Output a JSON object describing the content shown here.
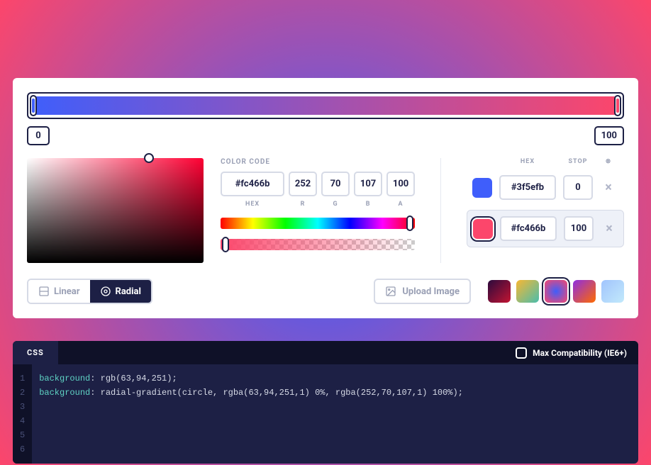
{
  "gradient": {
    "stop_left": "0",
    "stop_right": "100",
    "bar_gradient_css": "linear-gradient(90deg, #3f5efb 0%, #fc466b 100%)"
  },
  "colorcode": {
    "label": "COLOR CODE",
    "hex": "#fc466b",
    "r": "252",
    "g": "70",
    "b": "107",
    "a": "100",
    "sub_hex": "HEX",
    "sub_r": "R",
    "sub_g": "G",
    "sub_b": "B",
    "sub_a": "A"
  },
  "stops": {
    "header_hex": "HEX",
    "header_stop": "STOP",
    "header_del": "",
    "items": [
      {
        "color": "#3f5efb",
        "hex": "#3f5efb",
        "position": "0",
        "active": false
      },
      {
        "color": "#fc466b",
        "hex": "#fc466b",
        "position": "100",
        "active": true
      }
    ]
  },
  "toolbar": {
    "linear_label": "Linear",
    "radial_label": "Radial",
    "upload_label": "Upload Image"
  },
  "presets": [
    {
      "css": "linear-gradient(135deg,#2b0a3d,#c31432)"
    },
    {
      "css": "linear-gradient(135deg,#f7b733,#4abdac)"
    },
    {
      "css": "radial-gradient(circle,#3f5efb,#fc466b)"
    },
    {
      "css": "linear-gradient(135deg,#8e2de2,#ff6a00)"
    },
    {
      "css": "linear-gradient(135deg,#a1c4fd,#c2e9fb)"
    }
  ],
  "preset_selected": 2,
  "code": {
    "tab": "CSS",
    "compat_label": "Max Compatibility (IE6+)",
    "lines": [
      {
        "kw": "background",
        "rest": ": rgb(63,94,251);"
      },
      {
        "kw": "background",
        "rest": ": radial-gradient(circle, rgba(63,94,251,1) 0%, rgba(252,70,107,1) 100%);"
      },
      {
        "kw": "",
        "rest": ""
      },
      {
        "kw": "",
        "rest": ""
      },
      {
        "kw": "",
        "rest": ""
      },
      {
        "kw": "",
        "rest": ""
      }
    ]
  }
}
